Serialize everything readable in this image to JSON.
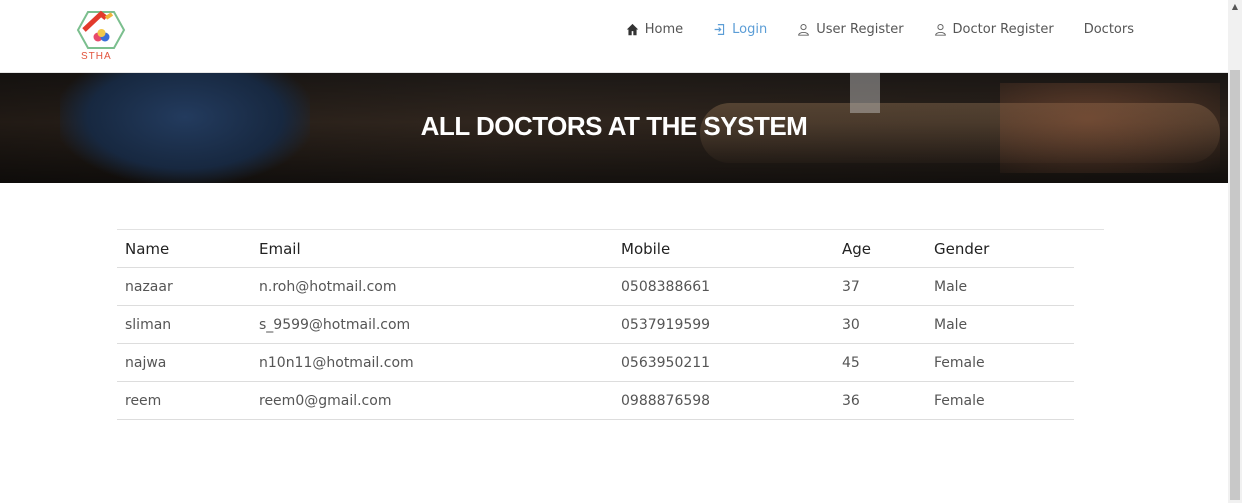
{
  "logo": {
    "text": "STHA"
  },
  "nav": {
    "items": [
      {
        "label": "Home",
        "icon": "home-icon"
      },
      {
        "label": "Login",
        "icon": "login-icon"
      },
      {
        "label": "User Register",
        "icon": "user-icon"
      },
      {
        "label": "Doctor Register",
        "icon": "user-icon"
      },
      {
        "label": "Doctors",
        "icon": ""
      }
    ],
    "active_color": "#5b9dd6"
  },
  "hero": {
    "title": "ALL DOCTORS AT THE SYSTEM"
  },
  "table": {
    "headers": [
      "Name",
      "Email",
      "Mobile",
      "Age",
      "Gender"
    ],
    "rows": [
      {
        "name": "nazaar",
        "email": "n.roh@hotmail.com",
        "mobile": "0508388661",
        "age": "37",
        "gender": "Male"
      },
      {
        "name": "sliman",
        "email": "s_9599@hotmail.com",
        "mobile": "0537919599",
        "age": "30",
        "gender": "Male"
      },
      {
        "name": "najwa",
        "email": "n10n11@hotmail.com",
        "mobile": "0563950211",
        "age": "45",
        "gender": "Female"
      },
      {
        "name": "reem",
        "email": "reem0@gmail.com",
        "mobile": "0988876598",
        "age": "36",
        "gender": "Female"
      }
    ]
  }
}
